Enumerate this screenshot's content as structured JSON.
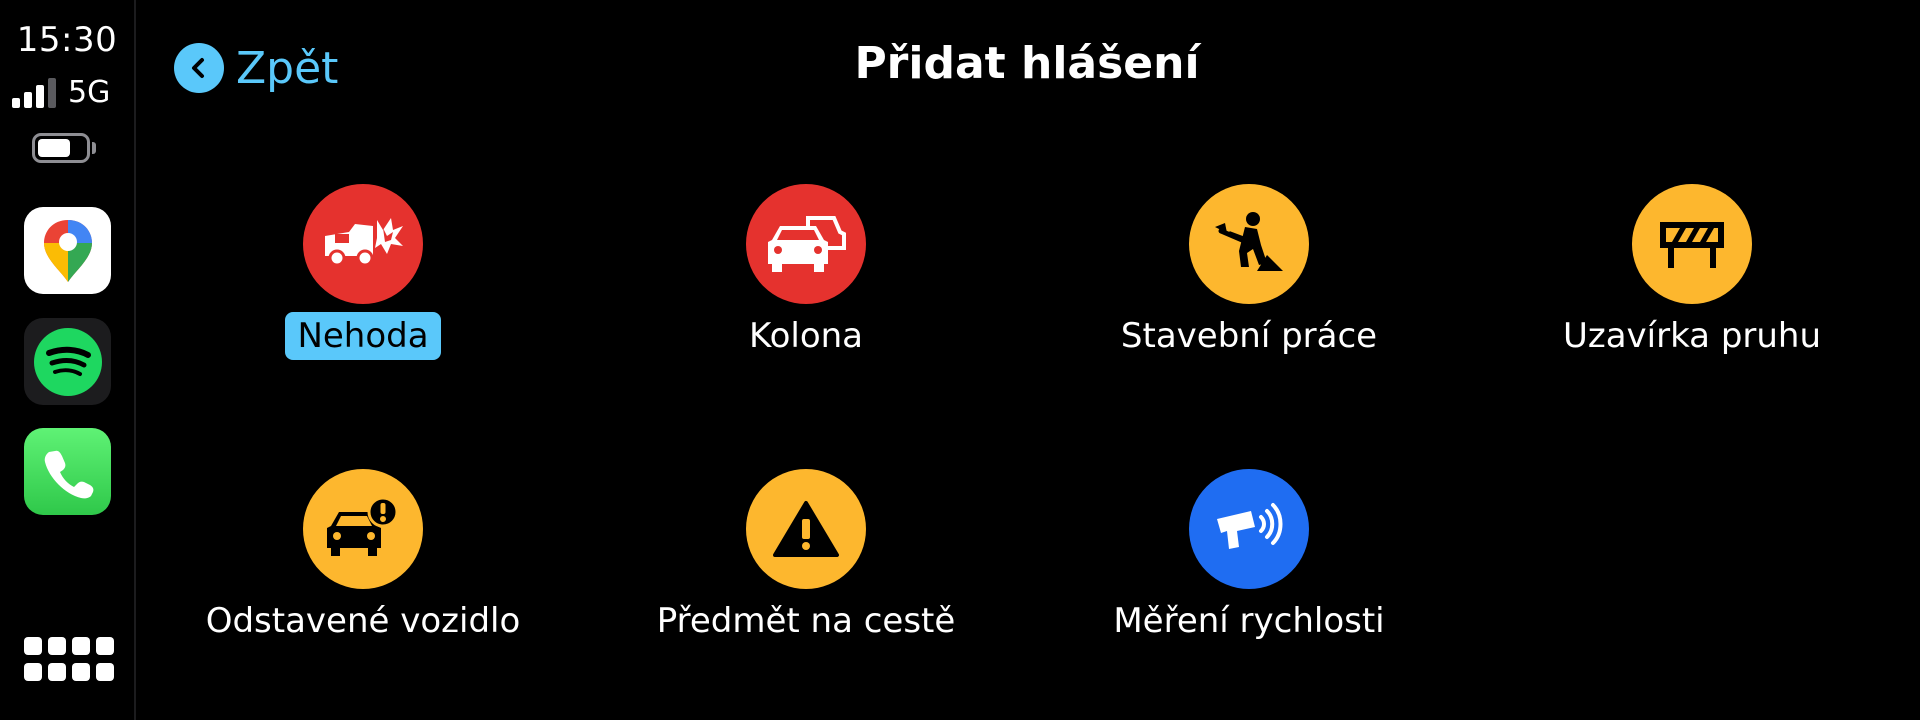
{
  "status_bar": {
    "time": "15:30",
    "network": "5G",
    "signal_strength": 3,
    "signal_max": 4,
    "battery_level": 0.7
  },
  "sidebar": {
    "apps": [
      {
        "name": "google-maps-app",
        "icon": "maps-pin-icon"
      },
      {
        "name": "spotify-app",
        "icon": "spotify-icon"
      },
      {
        "name": "phone-app",
        "icon": "phone-icon"
      }
    ],
    "menu_icon": "app-grid-icon"
  },
  "header": {
    "back_label": "Zpět",
    "title": "Přidat hlášení"
  },
  "reports": [
    {
      "label": "Nehoda",
      "icon": "crash-icon",
      "color": "#e5322e",
      "selected": true
    },
    {
      "label": "Kolona",
      "icon": "traffic-jam-icon",
      "color": "#e5322e",
      "selected": false
    },
    {
      "label": "Stavební práce",
      "icon": "roadwork-icon",
      "color": "#fdb72e",
      "selected": false
    },
    {
      "label": "Uzavírka pruhu",
      "icon": "lane-closure-icon",
      "color": "#fdb72e",
      "selected": false
    },
    {
      "label": "Odstavené vozidlo",
      "icon": "stalled-vehicle-icon",
      "color": "#fdb72e",
      "selected": false
    },
    {
      "label": "Předmět na cestě",
      "icon": "hazard-warning-icon",
      "color": "#fdb72e",
      "selected": false
    },
    {
      "label": "Měření rychlosti",
      "icon": "speed-camera-icon",
      "color": "#1f6df2",
      "selected": false
    }
  ],
  "colors": {
    "accent": "#5ac8fa",
    "background": "#000000"
  }
}
